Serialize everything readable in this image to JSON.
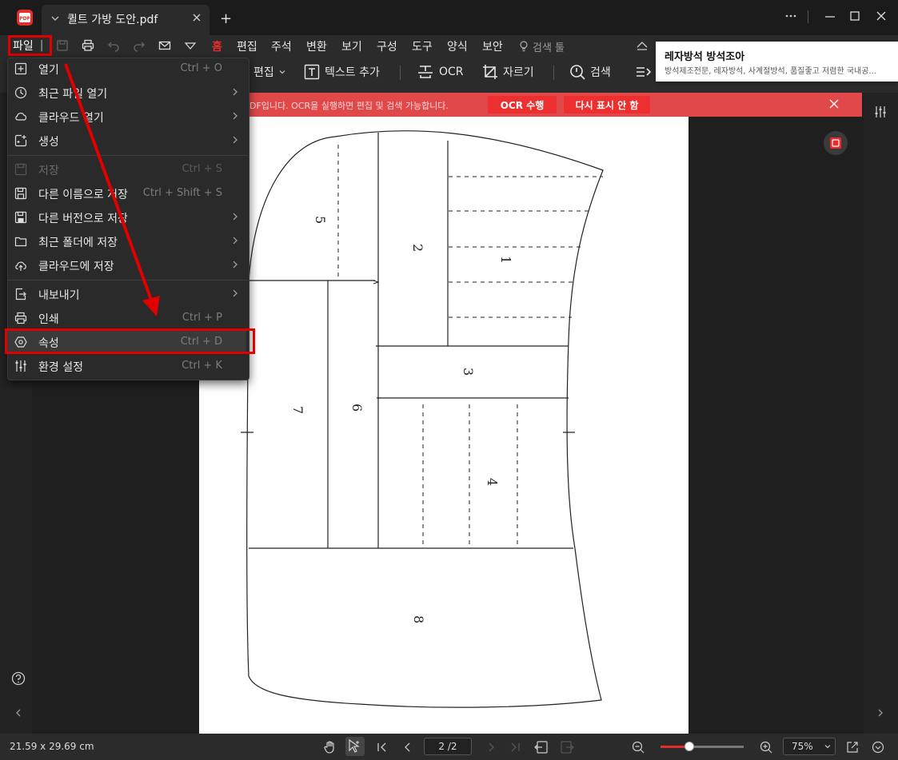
{
  "titlebar": {
    "tab_title": "퀼트 가방 도안.pdf",
    "new_tab": "+"
  },
  "menu": {
    "file": "파일",
    "items": [
      "홈",
      "편집",
      "주석",
      "변환",
      "보기",
      "구성",
      "도구",
      "양식",
      "보안"
    ],
    "active_item": "홈",
    "search": "검색 툴"
  },
  "toolbar": {
    "edit": "편집",
    "add_text": "텍스트 추가",
    "ocr": "OCR",
    "crop": "자르기",
    "search": "검색"
  },
  "ad": {
    "title": "레자방석 방석조아",
    "desc": "방석제조전문, 레자방석, 사계절방석, 품질좋고 저렴한 국내공..."
  },
  "ocr_banner": {
    "text": "DF입니다. OCR을 실행하면 편집 및 검색 가능합니다.",
    "run_button": "OCR 수행",
    "hide_button": "다시 표시 안 함"
  },
  "file_menu": {
    "items": [
      {
        "label": "열기",
        "shortcut": "Ctrl + O",
        "icon": "open-icon",
        "submenu": false,
        "disabled": false
      },
      {
        "label": "최근 파일 열기",
        "shortcut": "",
        "icon": "clock-icon",
        "submenu": true,
        "disabled": false
      },
      {
        "label": "클라우드 열기",
        "shortcut": "",
        "icon": "cloud-icon",
        "submenu": true,
        "disabled": false
      },
      {
        "label": "생성",
        "shortcut": "",
        "icon": "create-icon",
        "submenu": true,
        "disabled": false
      },
      {
        "label": "저장",
        "shortcut": "Ctrl + S",
        "icon": "save-icon",
        "submenu": false,
        "disabled": true
      },
      {
        "label": "다른 이름으로 저장",
        "shortcut": "Ctrl + Shift + S",
        "icon": "save-as-icon",
        "submenu": false,
        "disabled": false
      },
      {
        "label": "다른 버전으로 저장",
        "shortcut": "",
        "icon": "save-version-icon",
        "submenu": true,
        "disabled": false
      },
      {
        "label": "최근 폴더에 저장",
        "shortcut": "",
        "icon": "folder-icon",
        "submenu": true,
        "disabled": false
      },
      {
        "label": "클라우드에 저장",
        "shortcut": "",
        "icon": "cloud-upload-icon",
        "submenu": true,
        "disabled": false
      },
      {
        "label": "내보내기",
        "shortcut": "",
        "icon": "export-icon",
        "submenu": true,
        "disabled": false
      },
      {
        "label": "인쇄",
        "shortcut": "Ctrl + P",
        "icon": "print-icon",
        "submenu": false,
        "disabled": false
      },
      {
        "label": "속성",
        "shortcut": "Ctrl + D",
        "icon": "properties-icon",
        "submenu": false,
        "disabled": false
      },
      {
        "label": "환경 설정",
        "shortcut": "Ctrl + K",
        "icon": "settings-icon",
        "submenu": false,
        "disabled": false
      }
    ]
  },
  "pattern_labels": [
    "5",
    "2",
    "1",
    "3",
    "7",
    "6",
    "4",
    "8"
  ],
  "status": {
    "page_size": "21.59 x 29.69 cm",
    "page_indicator": "2 /2",
    "zoom": "75%",
    "zoom_level": 0.35
  },
  "colors": {
    "accent": "#e52d2d",
    "highlight_box": "#e00000",
    "banner": "#e0484a"
  }
}
